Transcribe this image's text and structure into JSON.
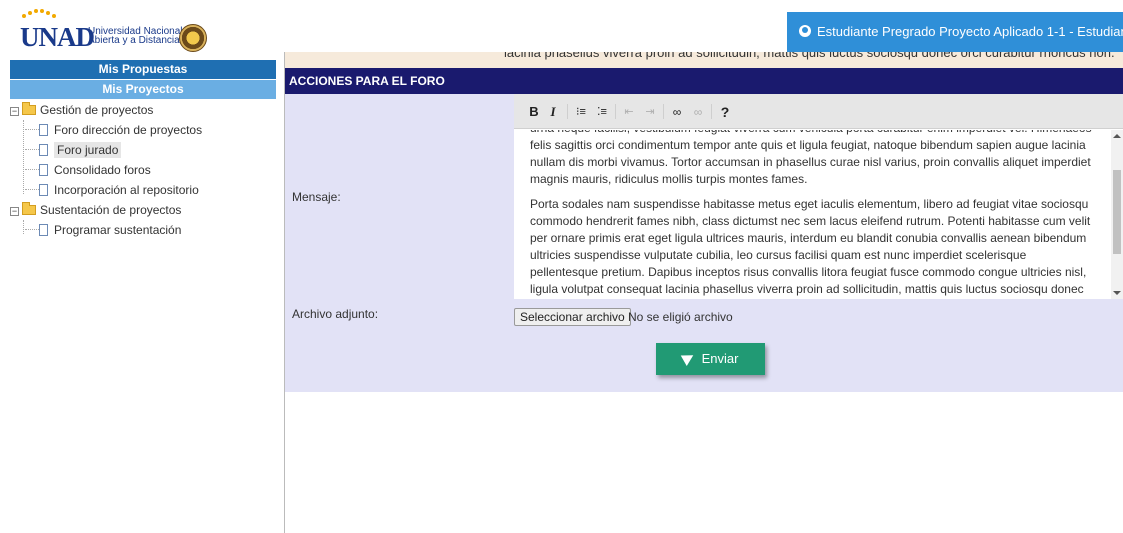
{
  "header": {
    "logo_text": "UNAD",
    "university_line1": "Universidad Nacional",
    "university_line2": "Abierta y a Distancia",
    "user_label": "Estudiante Pregrado Proyecto Aplicado 1-1 - Estudiant",
    "brand_color": "#2f8fd8"
  },
  "sidebar": {
    "buttons": [
      {
        "label": "Mis Propuestas"
      },
      {
        "label": "Mis Proyectos"
      }
    ],
    "tree": [
      {
        "label": "Gestión de proyectos",
        "children": [
          "Foro dirección de proyectos",
          "Foro jurado",
          "Consolidado foros",
          "Incorporación al repositorio"
        ]
      },
      {
        "label": "Sustentación de proyectos",
        "children": [
          "Programar sustentación"
        ]
      }
    ],
    "selected": "Foro jurado"
  },
  "main": {
    "top_strip_text": "lacinia phasellus viverra proin ad sollicitudin, mattis quis luctus sociosqu donec orci curabitur rhoncus non.",
    "section_title": "ACCIONES PARA EL FORO",
    "message_label": "Mensaje:",
    "attachment_label": "Archivo adjunto:",
    "toolbar": {
      "bold": "B",
      "italic": "I",
      "help": "?"
    },
    "editor_paragraphs": [
      "urna neque facilisi, vestibulum feugiat viverra cum vehicula porta curabitur enim imperdiet vel. Himenaeos felis sagittis orci condimentum tempor ante quis et ligula feugiat, natoque bibendum sapien augue lacinia nullam dis morbi vivamus. Tortor accumsan in phasellus curae nisl varius, proin convallis aliquet imperdiet magnis mauris, ridiculus mollis turpis montes fames.",
      "Porta sodales nam suspendisse habitasse metus eget iaculis elementum, libero ad feugiat vitae sociosqu commodo hendrerit fames nibh, class dictumst nec sem lacus eleifend rutrum. Potenti habitasse cum velit per ornare primis erat eget ligula ultrices mauris, interdum eu blandit conubia convallis aenean bibendum ultricies suspendisse vulputate cubilia, leo cursus facilisi quam est nunc imperdiet scelerisque pellentesque pretium. Dapibus inceptos risus convallis litora feugiat fusce commodo congue ultricies nisl, ligula volutpat consequat lacinia phasellus viverra proin ad sollicitudin, mattis quis luctus sociosqu donec orci curabitur rhoncus non."
    ],
    "file_button": "Seleccionar archivo",
    "file_status": "No se eligió archivo",
    "send_button": "Enviar",
    "send_color": "#219a74",
    "section_color": "#1a1a6e"
  }
}
